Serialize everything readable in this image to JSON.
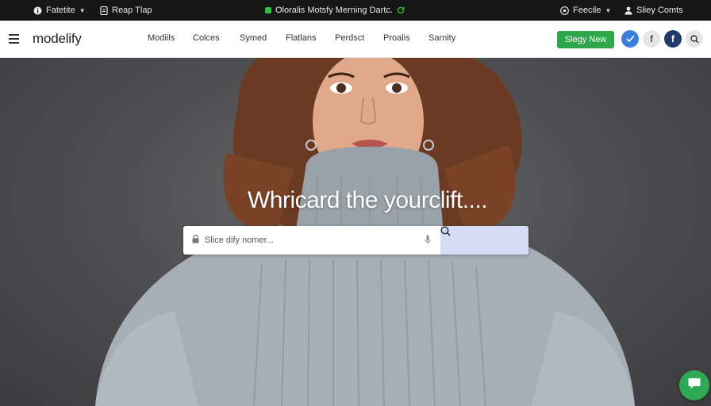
{
  "topbar": {
    "left1": {
      "label": "Fatetite",
      "icon": "info-icon"
    },
    "left2": {
      "label": "Reap Tlap",
      "icon": "document-icon"
    },
    "center": {
      "label": "Oloralis Motsfy Merning Dartс.",
      "icon": "refresh-icon"
    },
    "right1": {
      "label": "Feecile",
      "icon": "globe-icon"
    },
    "right2": {
      "label": "Sliey Comts",
      "icon": "user-icon"
    }
  },
  "nav": {
    "logo": "modelify",
    "links": [
      "Modiils",
      "Colces",
      "Symed",
      "Flatlans",
      "Perdsct",
      "Proalis",
      "Sarnity"
    ],
    "signup_label": "Slegy New",
    "social": [
      "twitter-icon",
      "facebook-icon",
      "facebook-icon",
      "search-icon"
    ]
  },
  "hero": {
    "title": "Whricard the yourclift....",
    "search_placeholder": "Slice dify nomer..."
  },
  "colors": {
    "accent_green": "#2ea64a",
    "topbar_bg": "#161616",
    "search_button_bg": "#d4dcf6"
  }
}
